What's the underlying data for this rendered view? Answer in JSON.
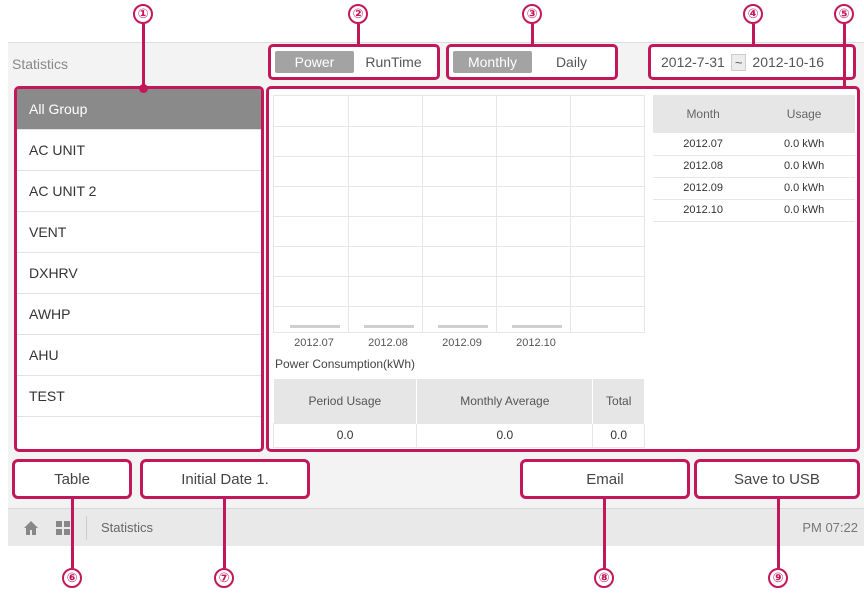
{
  "screen": {
    "title": "Statistics"
  },
  "view_toggle": {
    "options": [
      "Power",
      "RunTime"
    ],
    "selected": "Power"
  },
  "period_toggle": {
    "options": [
      "Monthly",
      "Daily"
    ],
    "selected": "Monthly"
  },
  "date_range": {
    "start": "2012-7-31",
    "separator": "~",
    "end": "2012-10-16"
  },
  "groups": {
    "items": [
      "All Group",
      "AC UNIT",
      "AC UNIT 2",
      "VENT",
      "DXHRV",
      "AWHP",
      "AHU",
      "TEST"
    ],
    "selected": "All Group"
  },
  "chart_data": {
    "type": "bar",
    "categories": [
      "2012.07",
      "2012.08",
      "2012.09",
      "2012.10"
    ],
    "values": [
      0,
      0,
      0,
      0
    ],
    "title": "Power Consumption(kWh)",
    "xlabel": "",
    "ylabel": "",
    "grid": true
  },
  "summary": {
    "headers": [
      "Period Usage",
      "Monthly Average",
      "Total"
    ],
    "values": [
      "0.0",
      "0.0",
      "0.0"
    ]
  },
  "usage_table": {
    "headers": [
      "Month",
      "Usage"
    ],
    "rows": [
      [
        "2012.07",
        "0.0 kWh"
      ],
      [
        "2012.08",
        "0.0 kWh"
      ],
      [
        "2012.09",
        "0.0 kWh"
      ],
      [
        "2012.10",
        "0.0 kWh"
      ]
    ]
  },
  "buttons": {
    "table": "Table",
    "initial_date": "Initial Date 1.",
    "email": "Email",
    "save_usb": "Save to USB"
  },
  "status_bar": {
    "label": "Statistics",
    "time": "PM 07:22",
    "icons": [
      "home-icon",
      "grid-icon"
    ]
  },
  "callouts": [
    "①",
    "②",
    "③",
    "④",
    "⑤",
    "⑥",
    "⑦",
    "⑧",
    "⑨"
  ],
  "colors": {
    "callout": "#c2185b",
    "selected_bg": "#8a8a8a",
    "toggle_active_bg": "#a3a3a3"
  }
}
